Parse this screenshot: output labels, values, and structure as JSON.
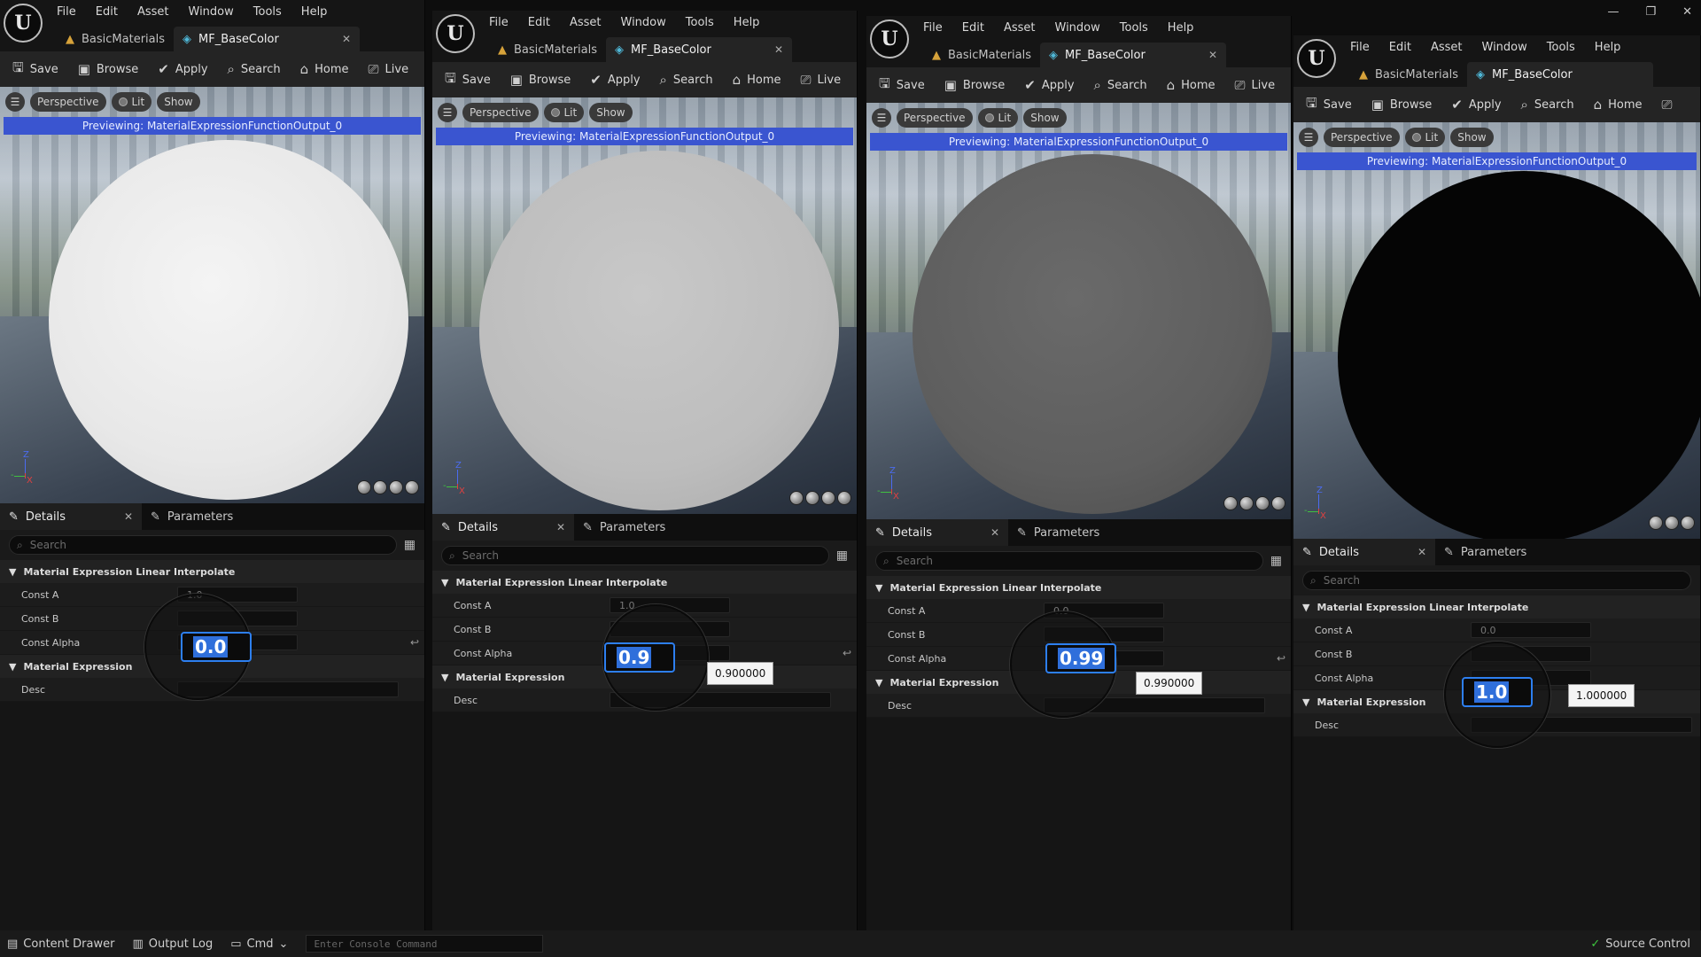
{
  "colors": {
    "accent": "#3a55d0",
    "selection": "#2f6fdb",
    "source_control_ok": "#3ec63e"
  },
  "menu": [
    "File",
    "Edit",
    "Asset",
    "Window",
    "Tools",
    "Help"
  ],
  "tabs": {
    "material": "BasicMaterials",
    "function": "MF_BaseColor"
  },
  "toolbar": {
    "save": "Save",
    "browse": "Browse",
    "apply": "Apply",
    "search": "Search",
    "home": "Home",
    "live": "Live"
  },
  "viewport": {
    "perspective": "Perspective",
    "lit": "Lit",
    "show": "Show",
    "preview_text": "Previewing: MaterialExpressionFunctionOutput_0"
  },
  "details": {
    "tab": "Details",
    "params_tab": "Parameters",
    "search_placeholder": "Search",
    "category1": "Material Expression Linear Interpolate",
    "const_a_label": "Const A",
    "const_b_label": "Const B",
    "const_alpha_label": "Const Alpha",
    "category2": "Material Expression",
    "desc_label": "Desc"
  },
  "panels": [
    {
      "const_a": "1.0",
      "const_alpha": "0.0",
      "tooltip": "",
      "sphere_color": "#e8e8e8"
    },
    {
      "const_a": "1.0",
      "const_alpha": "0.9",
      "tooltip": "0.900000",
      "sphere_color": "#bdbdbd"
    },
    {
      "const_a": "0.0",
      "const_alpha": "0.99",
      "tooltip": "0.990000",
      "sphere_color": "#5e5e5e"
    },
    {
      "const_a": "0.0",
      "const_alpha": "1.0",
      "tooltip": "1.000000",
      "sphere_color": "#050505"
    }
  ],
  "statusbar": {
    "content_drawer": "Content Drawer",
    "output_log": "Output Log",
    "cmd": "Cmd",
    "console_placeholder": "Enter Console Command",
    "source_control": "Source Control"
  }
}
